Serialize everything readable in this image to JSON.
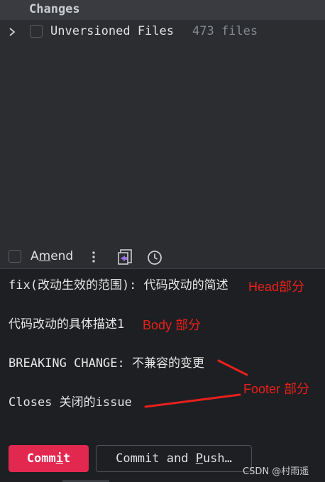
{
  "changes": {
    "header": "Changes",
    "unversioned": {
      "label": "Unversioned Files",
      "count": "473 files"
    }
  },
  "toolbar": {
    "amend_prefix": "A",
    "amend_mnemonic": "m",
    "amend_suffix": "end"
  },
  "message": {
    "head": "fix(改动生效的范围): 代码改动的简述",
    "body": "代码改动的具体描述1",
    "breaking": "BREAKING CHANGE: 不兼容的变更",
    "closes": "Closes 关闭的issue"
  },
  "annotations": {
    "head": "Head部分",
    "body": "Body 部分",
    "footer": "Footer 部分",
    "color": "#e8201c"
  },
  "buttons": {
    "commit_prefix": "Comm",
    "commit_mnemonic": "i",
    "commit_suffix": "t",
    "push_prefix": "Commit and ",
    "push_mnemonic": "P",
    "push_suffix": "ush…"
  },
  "watermark": "CSDN @村雨遥",
  "colors": {
    "accent": "#e3284f",
    "panel_bg": "#2b2d30",
    "editor_bg": "#1e1f22"
  },
  "icons": [
    "chevron-right-icon",
    "kebab-menu-icon",
    "diff-icon",
    "history-clock-icon"
  ]
}
